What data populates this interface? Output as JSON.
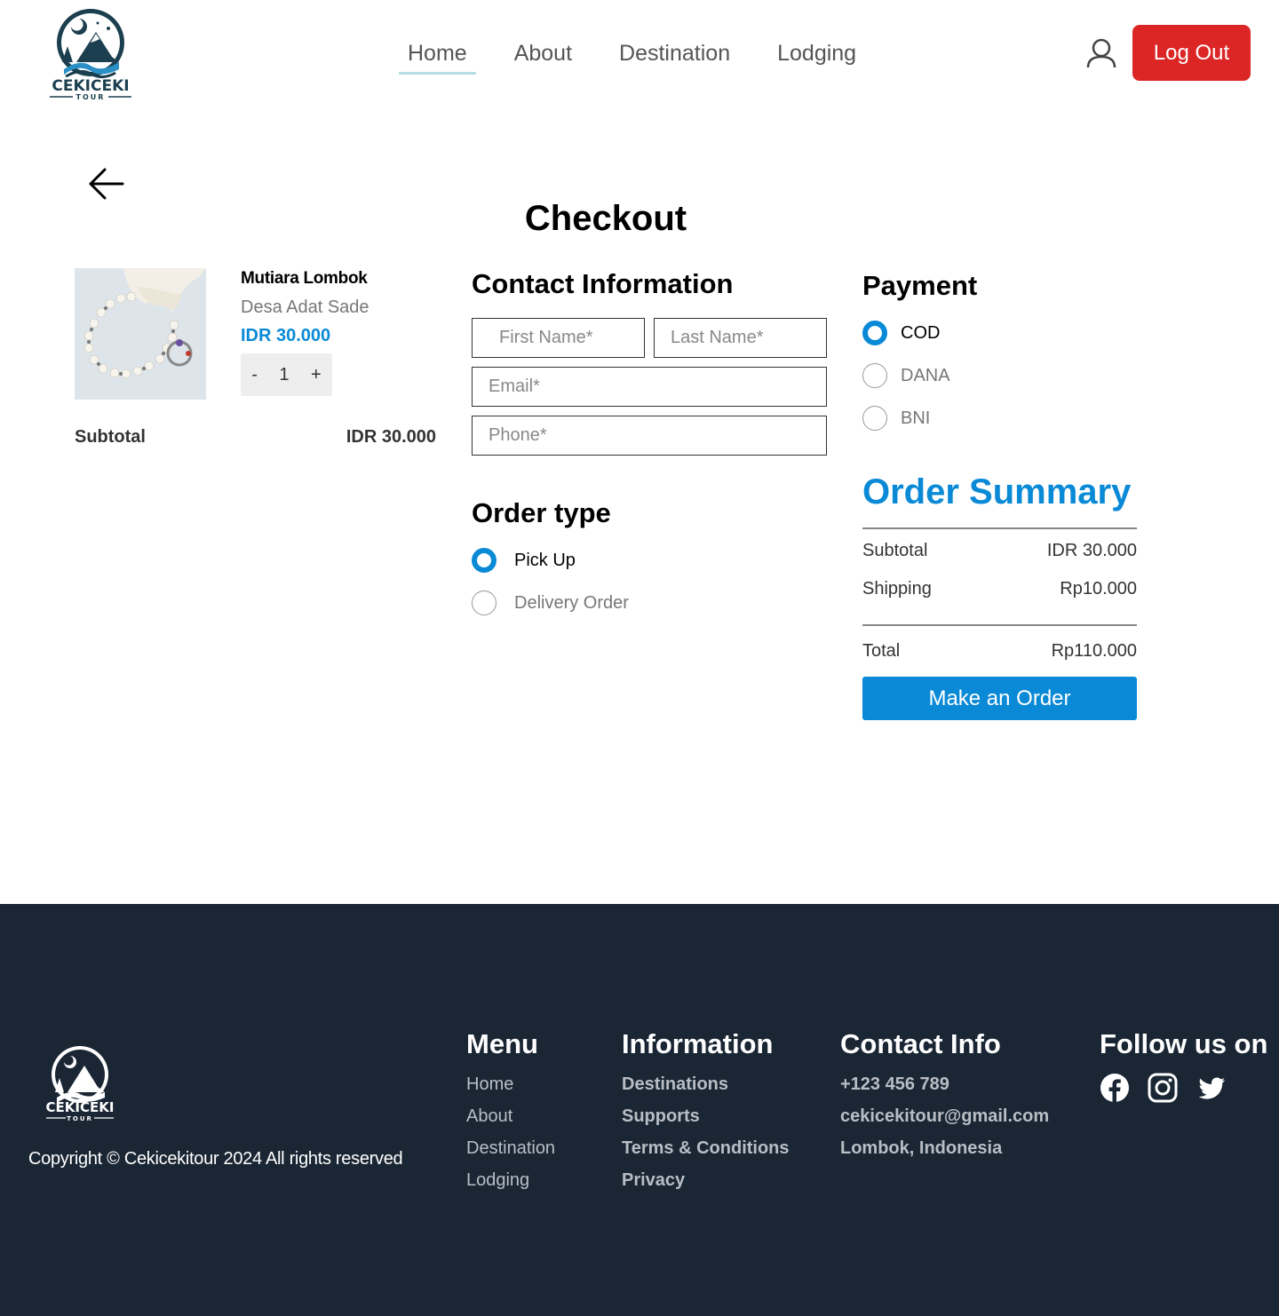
{
  "header": {
    "logo_text": "CEKICEKI TOUR",
    "nav": [
      {
        "label": "Home",
        "active": true
      },
      {
        "label": "About"
      },
      {
        "label": "Destination"
      },
      {
        "label": "Lodging"
      }
    ],
    "logout_label": "Log Out"
  },
  "page": {
    "title": "Checkout"
  },
  "product": {
    "name": "Mutiara Lombok",
    "location": "Desa Adat Sade",
    "price": "IDR 30.000",
    "qty_minus": "-",
    "qty_value": "1",
    "qty_plus": "+",
    "subtotal_label": "Subtotal",
    "subtotal_value": "IDR 30.000"
  },
  "contact": {
    "title": "Contact Information",
    "first_name_placeholder": "First Name*",
    "last_name_placeholder": "Last Name*",
    "email_placeholder": "Email*",
    "phone_placeholder": "Phone*"
  },
  "order_type": {
    "title": "Order type",
    "options": [
      {
        "label": "Pick Up",
        "checked": true
      },
      {
        "label": "Delivery Order",
        "checked": false
      }
    ]
  },
  "payment": {
    "title": "Payment",
    "options": [
      {
        "label": "COD",
        "checked": true
      },
      {
        "label": "DANA",
        "checked": false
      },
      {
        "label": "BNI",
        "checked": false
      }
    ]
  },
  "summary": {
    "title": "Order Summary",
    "subtotal_label": "Subtotal",
    "subtotal_value": "IDR 30.000",
    "shipping_label": "Shipping",
    "shipping_value": "Rp10.000",
    "total_label": "Total",
    "total_value": "Rp110.000",
    "order_button": "Make an Order"
  },
  "footer": {
    "logo_text": "CEKICEKI TOUR",
    "copyright": "Copyright © Cekicekitour 2024 All rights reserved",
    "menu_title": "Menu",
    "menu": [
      "Home",
      "About",
      "Destination",
      "Lodging"
    ],
    "info_title": "Information",
    "info": [
      "Destinations",
      "Supports",
      "Terms & Conditions",
      "Privacy"
    ],
    "contact_title": "Contact Info",
    "contact": [
      "+123 456 789",
      "cekicekitour@gmail.com",
      "Lombok, Indonesia"
    ],
    "follow_title": "Follow us on",
    "social_icons": [
      "facebook-icon",
      "instagram-icon",
      "twitter-icon"
    ]
  },
  "colors": {
    "accent": "#0a8ad6",
    "logout": "#dc2626",
    "footer_bg": "#1a2634"
  }
}
